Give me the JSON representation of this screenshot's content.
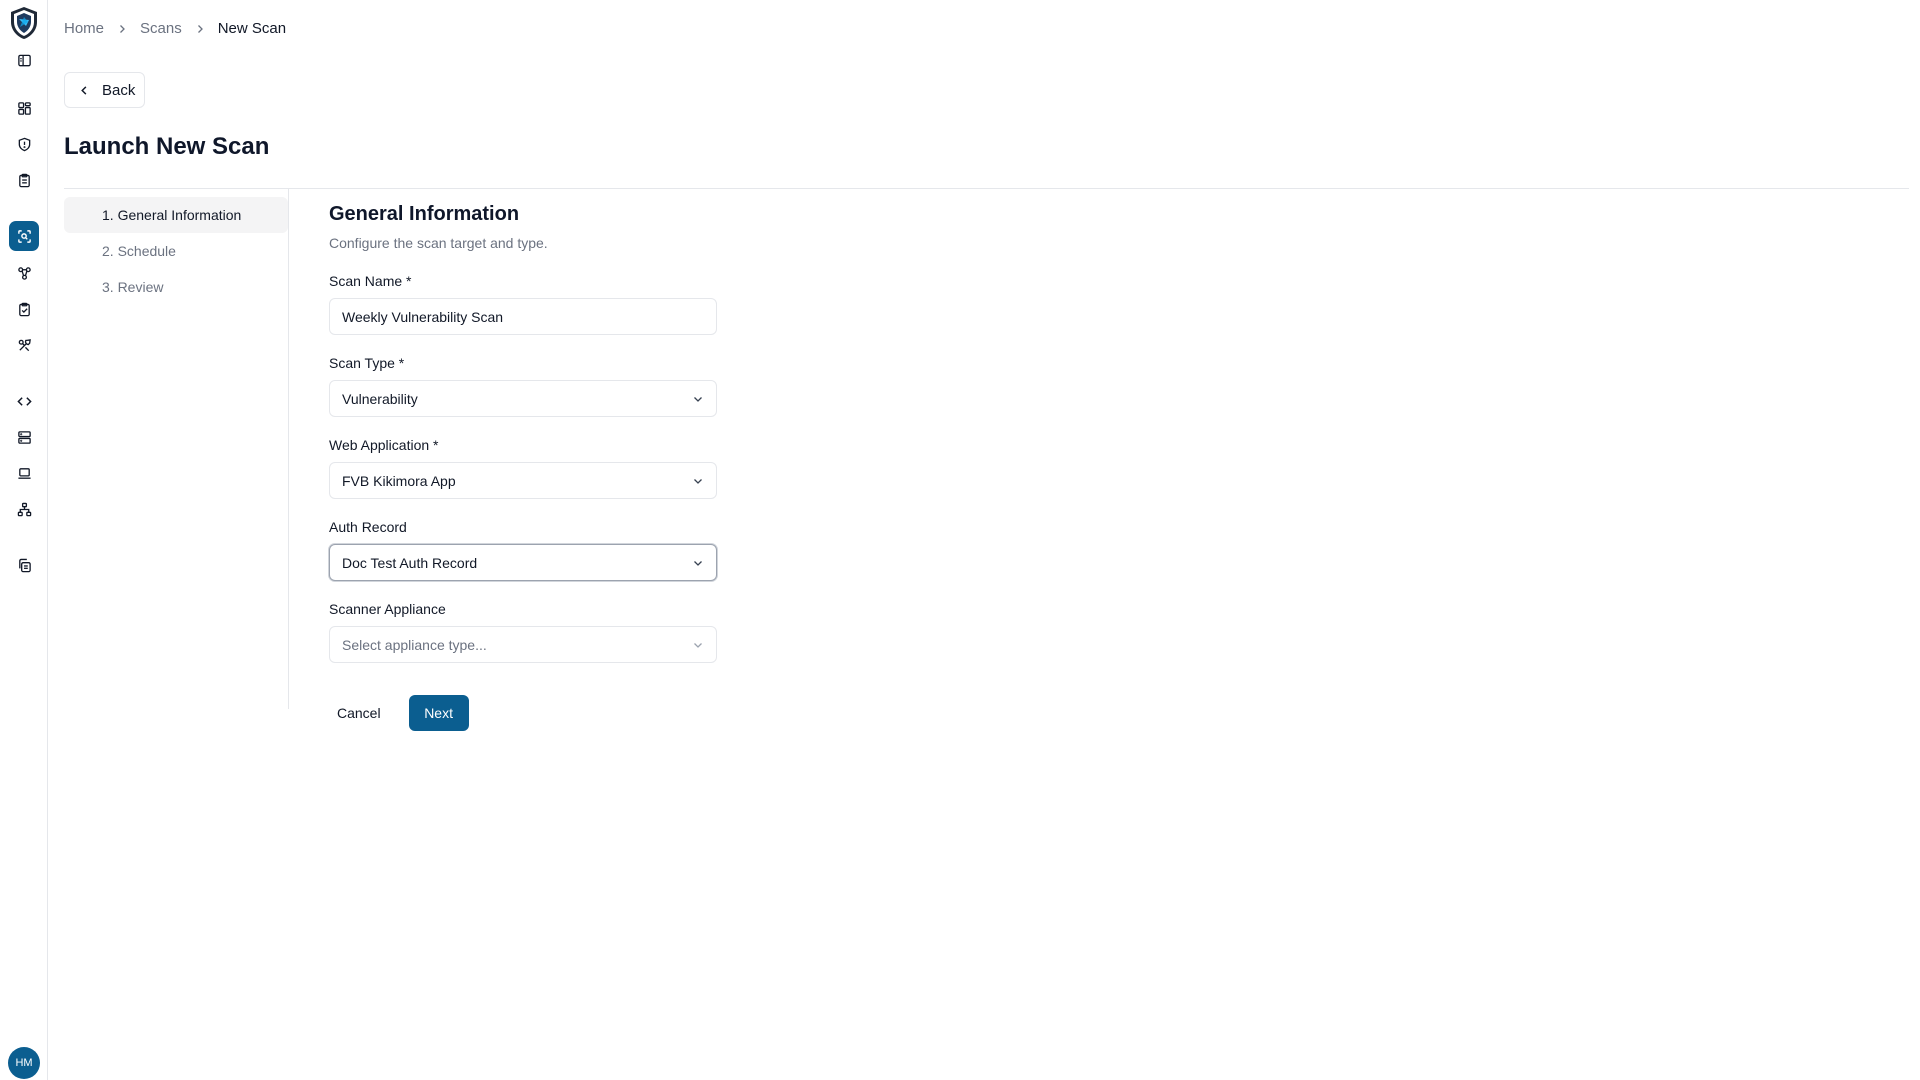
{
  "colors": {
    "accent": "#0b5e90",
    "border": "#e5e7eb",
    "muted_text": "#6b7280"
  },
  "sidebar": {
    "logo": "shield-logo",
    "items": [
      {
        "icon": "panel-toggle-icon",
        "active": false
      },
      {
        "icon": "dashboard-icon",
        "active": false
      },
      {
        "icon": "shield-icon",
        "active": false
      },
      {
        "icon": "clipboard-icon",
        "active": false
      },
      {
        "icon": "scan-icon",
        "active": true
      },
      {
        "icon": "network-icon",
        "active": false
      },
      {
        "icon": "clipboard-check-icon",
        "active": false
      },
      {
        "icon": "tools-icon",
        "active": false
      },
      {
        "icon": "code-icon",
        "active": false
      },
      {
        "icon": "server-icon",
        "active": false
      },
      {
        "icon": "laptop-icon",
        "active": false
      },
      {
        "icon": "hierarchy-icon",
        "active": false
      },
      {
        "icon": "copy-icon",
        "active": false
      }
    ],
    "avatar_initials": "HM"
  },
  "breadcrumb": {
    "home": "Home",
    "scans": "Scans",
    "current": "New Scan"
  },
  "back_label": "Back",
  "page_title": "Launch New Scan",
  "steps": [
    {
      "label": "1. General Information",
      "active": true
    },
    {
      "label": "2. Schedule",
      "active": false
    },
    {
      "label": "3. Review",
      "active": false
    }
  ],
  "form": {
    "title": "General Information",
    "description": "Configure the scan target and type.",
    "scan_name": {
      "label": "Scan Name *",
      "value": "Weekly Vulnerability Scan"
    },
    "scan_type": {
      "label": "Scan Type *",
      "value": "Vulnerability"
    },
    "web_application": {
      "label": "Web Application *",
      "value": "FVB Kikimora App"
    },
    "auth_record": {
      "label": "Auth Record",
      "value": "Doc Test Auth Record"
    },
    "scanner_appliance": {
      "label": "Scanner Appliance",
      "placeholder": "Select appliance type..."
    }
  },
  "actions": {
    "cancel": "Cancel",
    "next": "Next"
  }
}
